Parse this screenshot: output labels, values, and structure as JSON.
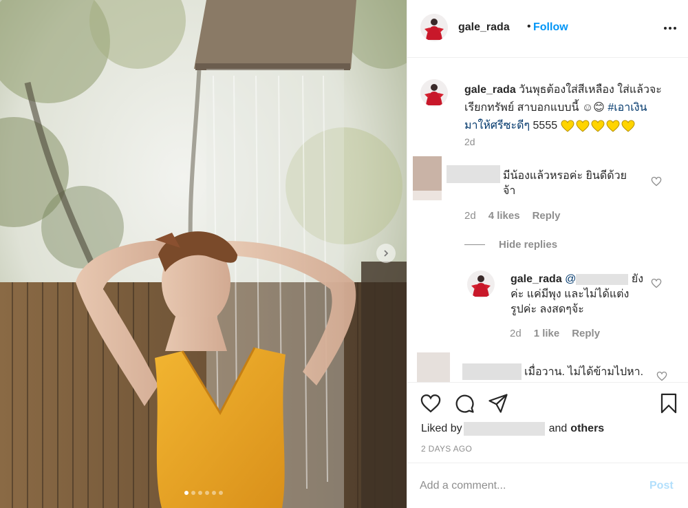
{
  "header": {
    "username": "gale_rada",
    "separator": "•",
    "follow_label": "Follow"
  },
  "caption": {
    "username": "gale_rada",
    "text_line1": "วันพุธต้องใส่สีเหลือง ใส่แล้วจะ",
    "text_line2": "เรียกทรัพย์ สาบอกแบบนี้ ☺😊",
    "hashtag1": "#เอาเงิน",
    "hashtag2": "มาให้ศรีซะดีๆ",
    "text_after": "5555",
    "time": "2d"
  },
  "comments": [
    {
      "text_line1": "มีน้องแล้วหรอค่ะ ยินดีด้วย",
      "text_line2": "จ้า",
      "time": "2d",
      "likes": "4 likes",
      "reply_label": "Reply"
    }
  ],
  "hide_replies_label": "Hide replies",
  "reply": {
    "username": "gale_rada",
    "mention": "@",
    "text_line1_tail": "ยัง",
    "text_line2": "ค่ะ แค่มีพุง และไม่ได้แต่ง",
    "text_line3": "รูปค่ะ ลงสดๆจ้ะ",
    "time": "2d",
    "likes": "1 like",
    "reply_label": "Reply"
  },
  "comment2": {
    "text": "เมื่อวาน. ไม่ได้ข้ามไปหา."
  },
  "liked_by": {
    "prefix": "Liked by",
    "and": "and",
    "others": "others"
  },
  "date": "2 DAYS AGO",
  "add_comment": {
    "placeholder": "Add a comment...",
    "post_label": "Post"
  },
  "colors": {
    "accent_blue": "#0095f6",
    "hashtag": "#00376b",
    "muted": "#8e8e8e",
    "dress_yellow": "#e8a21c"
  },
  "carousel": {
    "slide_count": 6,
    "active_index": 0
  },
  "icons": [
    "more-icon",
    "heart-icon",
    "comment-icon",
    "share-icon",
    "save-icon",
    "chevron-right-icon"
  ]
}
